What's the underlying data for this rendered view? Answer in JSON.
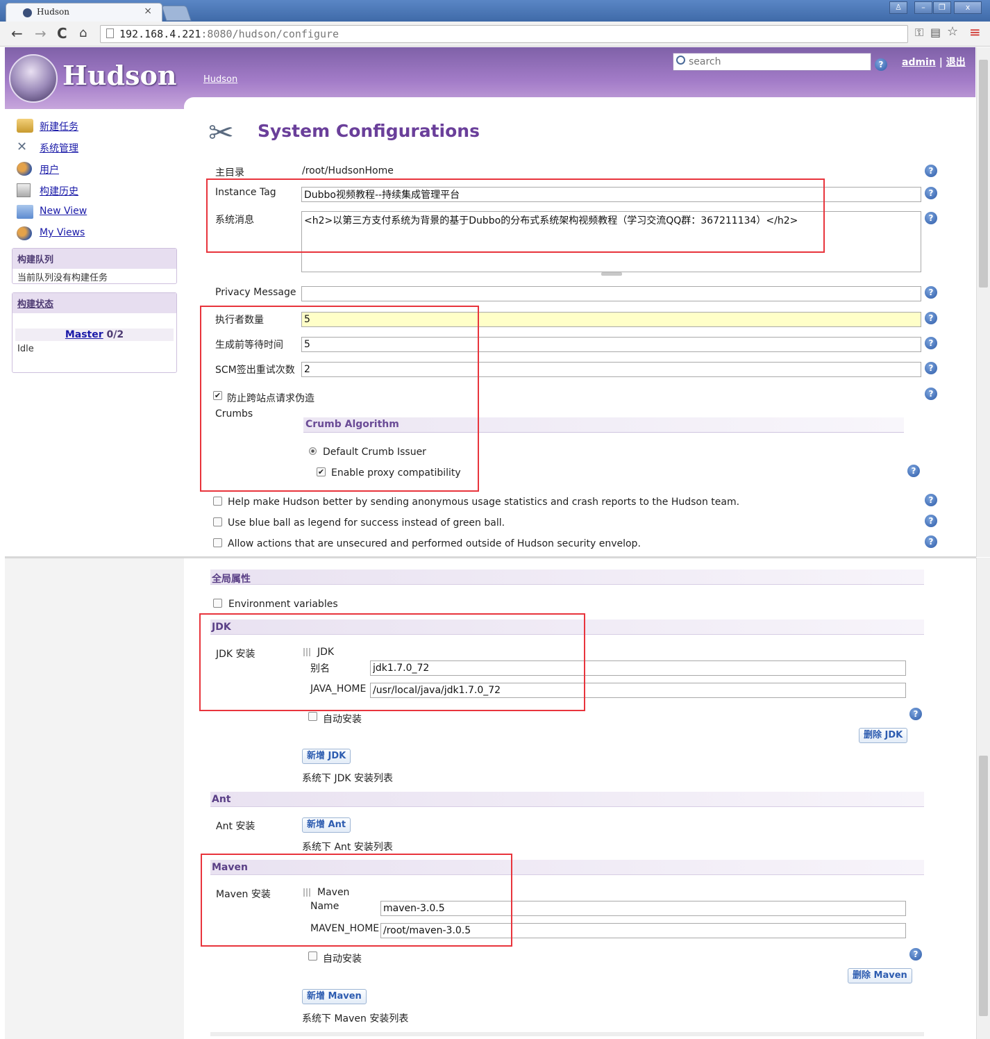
{
  "browser": {
    "tab_title": "Hudson",
    "tab_close": "×",
    "url_host": "192.168.4.221",
    "url_path": ":8080/hudson/configure"
  },
  "header": {
    "logo_text": "Hudson",
    "breadcrumb": "Hudson",
    "search_placeholder": "search",
    "user": "admin",
    "separator": "|",
    "logout": "退出"
  },
  "sidebar": {
    "items": [
      {
        "label": "新建任务",
        "icon": "new-job-icon"
      },
      {
        "label": "系统管理",
        "icon": "tools-icon"
      },
      {
        "label": "用户",
        "icon": "users-icon"
      },
      {
        "label": "构建历史",
        "icon": "history-icon"
      },
      {
        "label": "New View",
        "icon": "folder-icon"
      },
      {
        "label": "My Views",
        "icon": "users-icon"
      }
    ],
    "queue_title": "构建队列",
    "queue_empty": "当前队列没有构建任务",
    "executor_title": "构建状态",
    "master_label": "Master",
    "master_count": "0/2",
    "idle": "Idle"
  },
  "main": {
    "page_title": "System Configurations",
    "home_label": "主目录",
    "home_value": "/root/HudsonHome",
    "instance_tag_label": "Instance Tag",
    "instance_tag_value": "Dubbo视频教程--持续集成管理平台",
    "system_message_label": "系统消息",
    "system_message_value": "<h2>以第三方支付系统为背景的基于Dubbo的分布式系统架构视频教程（学习交流QQ群：367211134）</h2>",
    "privacy_label": "Privacy Message",
    "privacy_value": "",
    "executors_label": "执行者数量",
    "executors_value": "5",
    "quiet_label": "生成前等待时间",
    "quiet_value": "5",
    "scm_label": "SCM签出重试次数",
    "scm_value": "2",
    "csrf_label": "防止跨站点请求伪造",
    "crumbs_label": "Crumbs",
    "crumb_algo_title": "Crumb Algorithm",
    "crumb_default": "Default Crumb Issuer",
    "crumb_proxy": "Enable proxy compatibility",
    "opt_usage": "Help make Hudson better by sending anonymous usage statistics and crash reports to the Hudson team.",
    "opt_blueball": "Use blue ball as legend for success instead of green ball.",
    "opt_unsecured": "Allow actions that are unsecured and performed outside of Hudson security envelop.",
    "global_props_title": "全局属性",
    "env_vars": "Environment variables",
    "jdk_title": "JDK",
    "jdk_install_label": "JDK 安装",
    "jdk_sub": "JDK",
    "jdk_alias_label": "别名",
    "jdk_alias_value": "jdk1.7.0_72",
    "java_home_label": "JAVA_HOME",
    "java_home_value": "/usr/local/java/jdk1.7.0_72",
    "auto_install": "自动安装",
    "delete_jdk": "删除 JDK",
    "add_jdk": "新增 JDK",
    "jdk_list_note": "系统下 JDK 安装列表",
    "ant_title": "Ant",
    "ant_install_label": "Ant 安装",
    "add_ant": "新增 Ant",
    "ant_list_note": "系统下 Ant 安装列表",
    "maven_title": "Maven",
    "maven_install_label": "Maven 安装",
    "maven_sub": "Maven",
    "maven_name_label": "Name",
    "maven_name_value": "maven-3.0.5",
    "maven_home_label": "MAVEN_HOME",
    "maven_home_value": "/root/maven-3.0.5",
    "delete_maven": "删除 Maven",
    "add_maven": "新增 Maven",
    "maven_list_note": "系统下 Maven 安装列表"
  },
  "colors": {
    "header_purple": "#a37cc8",
    "section_text": "#5a3f86",
    "highlight_red": "#e8343c",
    "link_blue": "#1a1aa8",
    "executors_bg": "#ffffc8"
  }
}
